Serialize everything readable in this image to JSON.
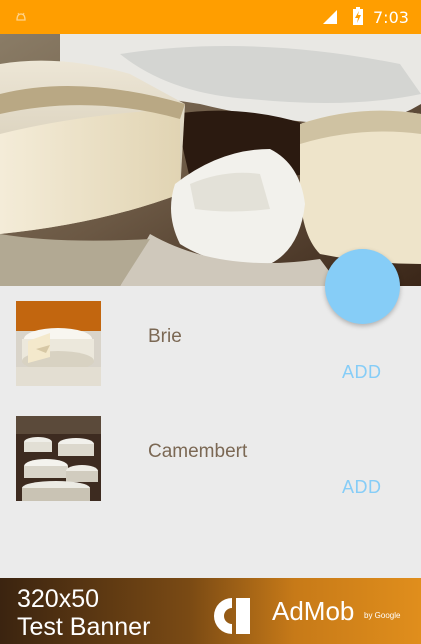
{
  "status_bar": {
    "time": "7:03",
    "icons": [
      "android-notification-icon",
      "signal-icon",
      "battery-charging-icon"
    ],
    "color": "#ff9e00"
  },
  "hero": {
    "image": "cheese-platter-photo"
  },
  "fab": {
    "color": "#86cdf7"
  },
  "items": [
    {
      "name": "Brie",
      "add_label": "ADD",
      "image": "brie-thumbnail"
    },
    {
      "name": "Camembert",
      "add_label": "ADD",
      "image": "camembert-thumbnail"
    }
  ],
  "ad": {
    "line1": "320x50",
    "line2": "Test Banner",
    "brand": "AdMob",
    "by": "by Google"
  },
  "colors": {
    "accent": "#86cdf7",
    "item_text": "#7b6854",
    "background": "#ebebeb"
  }
}
